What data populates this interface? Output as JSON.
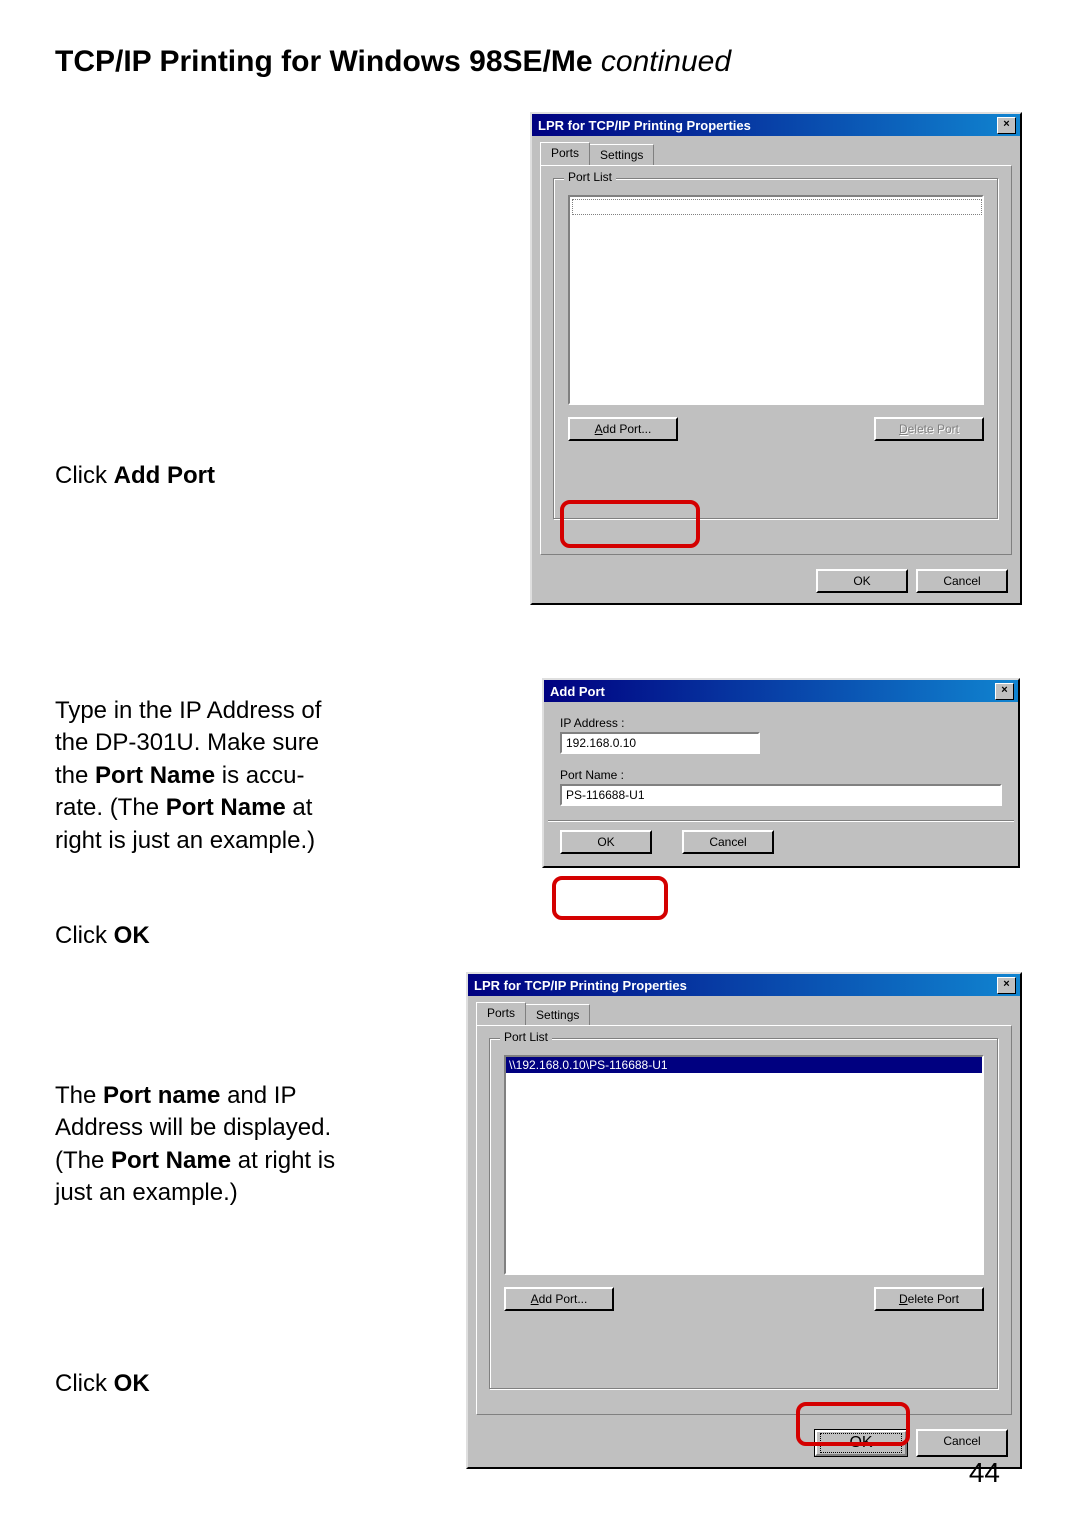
{
  "page": {
    "title_main": "TCP/IP Printing for Windows 98SE/Me ",
    "title_cont": "continued",
    "number": "44"
  },
  "instructions": {
    "step1_pre": "Click ",
    "step1_bold": "Add Port",
    "step2_line1": "Type in the IP Address of",
    "step2_line2": "the DP-301U. Make sure",
    "step2_line3a": "the ",
    "step2_line3b": "Port Name",
    "step2_line3c": " is accu-",
    "step2_line4a": "rate. (The ",
    "step2_line4b": "Port Name",
    "step2_line4c": " at",
    "step2_line5": "right is just an example.)",
    "step2_click_pre": "Click  ",
    "step2_click_bold": "OK",
    "step3_line1a": "The ",
    "step3_line1b": "Port name",
    "step3_line1c": " and IP",
    "step3_line2": "Address will be displayed.",
    "step3_line3a": "(The ",
    "step3_line3b": "Port Name",
    "step3_line3c": " at right is",
    "step3_line4": "just an example.)",
    "step3_click_pre": "Click  ",
    "step3_click_bold": "OK"
  },
  "dialog1": {
    "title": "LPR for TCP/IP Printing Properties",
    "tab_ports": "Ports",
    "tab_settings": "Settings",
    "group_label": "Port List",
    "add_port_u": "A",
    "add_port_rest": "dd Port...",
    "delete_port_u": "D",
    "delete_port_rest": "elete Port",
    "ok": "OK",
    "cancel": "Cancel",
    "close": "×"
  },
  "dialog2": {
    "title": "Add Port",
    "ip_label": "IP Address :",
    "ip_value": "192.168.0.10",
    "portname_label": "Port Name :",
    "portname_value": "PS-116688-U1",
    "ok": "OK",
    "cancel": "Cancel",
    "close": "×"
  },
  "dialog3": {
    "title": "LPR for TCP/IP Printing Properties",
    "tab_ports": "Ports",
    "tab_settings": "Settings",
    "group_label": "Port List",
    "list_item": "\\\\192.168.0.10\\PS-116688-U1",
    "add_port_u": "A",
    "add_port_rest": "dd Port...",
    "delete_port_u": "D",
    "delete_port_rest": "elete Port",
    "ok": "OK",
    "cancel": "Cancel",
    "close": "×"
  }
}
